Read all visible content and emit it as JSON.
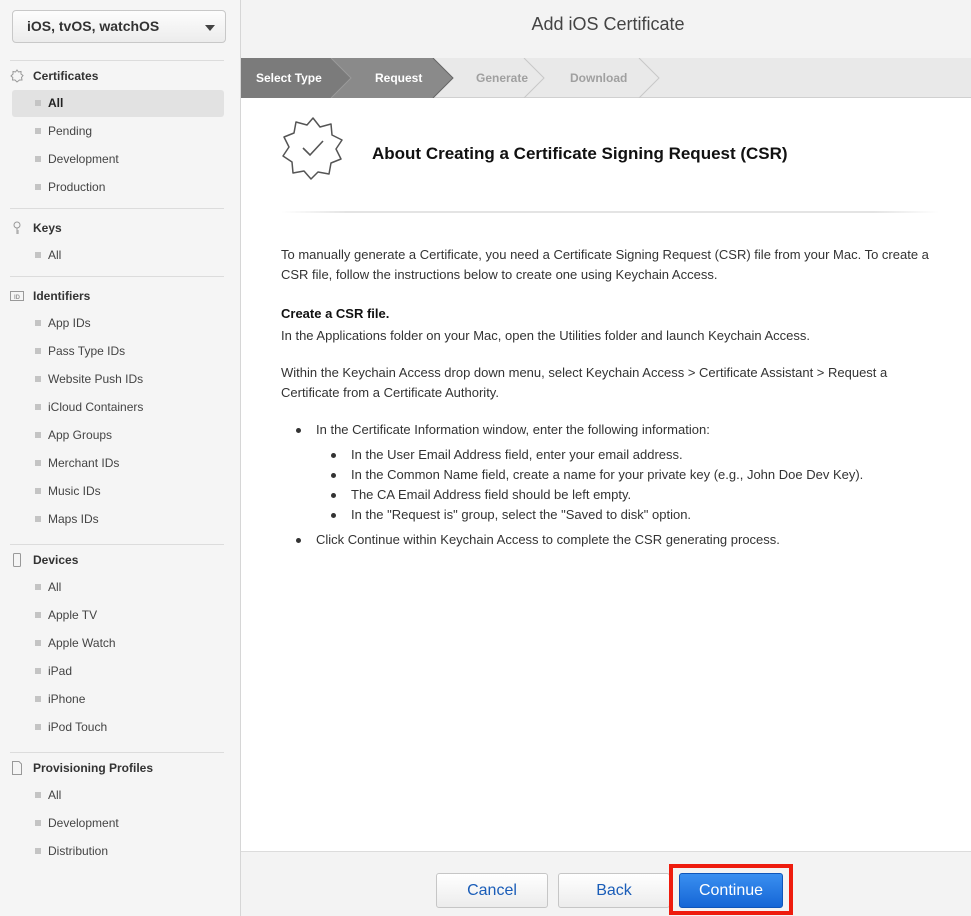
{
  "sidebar": {
    "platform": "iOS, tvOS, watchOS",
    "sections": {
      "certificates": {
        "label": "Certificates",
        "icon": "certificate-badge-icon",
        "items": [
          "All",
          "Pending",
          "Development",
          "Production"
        ]
      },
      "keys": {
        "label": "Keys",
        "icon": "key-icon",
        "items": [
          "All"
        ]
      },
      "identifiers": {
        "label": "Identifiers",
        "icon": "id-icon",
        "items": [
          "App IDs",
          "Pass Type IDs",
          "Website Push IDs",
          "iCloud Containers",
          "App Groups",
          "Merchant IDs",
          "Music IDs",
          "Maps IDs"
        ]
      },
      "devices": {
        "label": "Devices",
        "icon": "device-icon",
        "items": [
          "All",
          "Apple TV",
          "Apple Watch",
          "iPad",
          "iPhone",
          "iPod Touch"
        ]
      },
      "profiles": {
        "label": "Provisioning Profiles",
        "icon": "document-icon",
        "items": [
          "All",
          "Development",
          "Distribution"
        ]
      }
    }
  },
  "page": {
    "title": "Add iOS Certificate",
    "steps": [
      "Select Type",
      "Request",
      "Generate",
      "Download"
    ],
    "about_title": "About Creating a Certificate Signing Request (CSR)",
    "intro": "To manually generate a Certificate, you need a Certificate Signing Request (CSR) file from your Mac. To create a CSR file, follow the instructions below to create one using Keychain Access.",
    "csr_head": "Create a CSR file.",
    "csr_text": "In the Applications folder on your Mac, open the Utilities folder and launch Keychain Access.",
    "menu_text": "Within the Keychain Access drop down menu, select Keychain Access > Certificate Assistant > Request a Certificate from a Certificate Authority.",
    "bullet1": "In the Certificate Information window, enter the following information:",
    "sub_bullets": [
      "In the User Email Address field, enter your email address.",
      "In the Common Name field, create a name for your private key (e.g., John Doe Dev Key).",
      "The CA Email Address field should be left empty.",
      "In the \"Request is\" group, select the \"Saved to disk\" option."
    ],
    "bullet2": "Click Continue within Keychain Access to complete the CSR generating process."
  },
  "footer": {
    "cancel": "Cancel",
    "back": "Back",
    "continue": "Continue"
  },
  "colors": {
    "accent": "#1566d6",
    "highlight": "#ee1c0e",
    "step_done": "#7b7b7b"
  }
}
